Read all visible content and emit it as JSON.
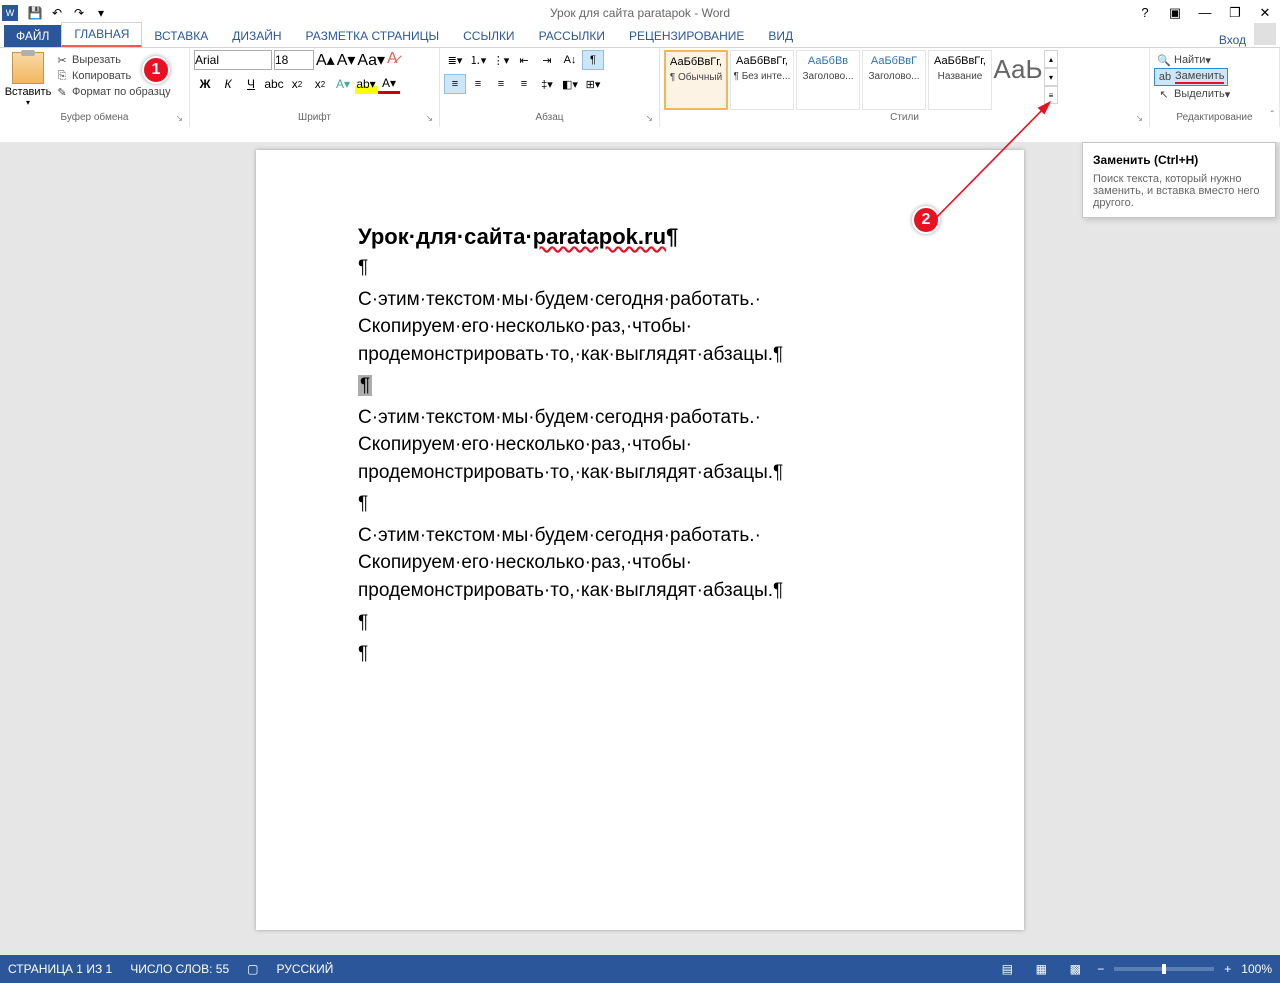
{
  "titlebar": {
    "title": "Урок для сайта paratapok - Word"
  },
  "tabs": {
    "file": "ФАЙЛ",
    "home": "ГЛАВНАЯ",
    "insert": "ВСТАВКА",
    "design": "ДИЗАЙН",
    "layout": "РАЗМЕТКА СТРАНИЦЫ",
    "refs": "ССЫЛКИ",
    "mailings": "РАССЫЛКИ",
    "review": "РЕЦЕНЗИРОВАНИЕ",
    "view": "ВИД",
    "login": "Вход"
  },
  "clipboard": {
    "paste": "Вставить",
    "cut": "Вырезать",
    "copy": "Копировать",
    "format": "Формат по образцу",
    "label": "Буфер обмена"
  },
  "font": {
    "name": "Arial",
    "size": "18",
    "label": "Шрифт",
    "bold": "Ж",
    "italic": "К",
    "underline": "Ч"
  },
  "para": {
    "label": "Абзац"
  },
  "styles": {
    "label": "Стили",
    "items": [
      {
        "prev": "АаБбВвГг,",
        "name": "¶ Обычный"
      },
      {
        "prev": "АаБбВвГг,",
        "name": "¶ Без инте..."
      },
      {
        "prev": "АаБбВв",
        "name": "Заголово..."
      },
      {
        "prev": "АаБбВвГ",
        "name": "Заголово..."
      },
      {
        "prev": "АаБбВвГг,",
        "name": "Название"
      },
      {
        "prev": "АаЬ",
        "name": ""
      }
    ]
  },
  "editing": {
    "find": "Найти",
    "replace": "Заменить",
    "select": "Выделить",
    "label": "Редактирование"
  },
  "tooltip": {
    "title": "Заменить (Ctrl+H)",
    "body": "Поиск текста, который нужно заменить, и вставка вместо него другого."
  },
  "doc": {
    "title_pre": "Урок·для·сайта·",
    "title_link": "paratapok.ru",
    "p": "С·этим·текстом·мы·будем·сегодня·работать.· Скопируем·его·несколько·раз,·чтобы· продемонстрировать·то,·как·выглядят·абзацы.¶"
  },
  "status": {
    "page": "СТРАНИЦА 1 ИЗ 1",
    "words": "ЧИСЛО СЛОВ: 55",
    "lang": "РУССКИЙ",
    "zoom": "100%"
  },
  "callouts": {
    "c1": "1",
    "c2": "2"
  }
}
